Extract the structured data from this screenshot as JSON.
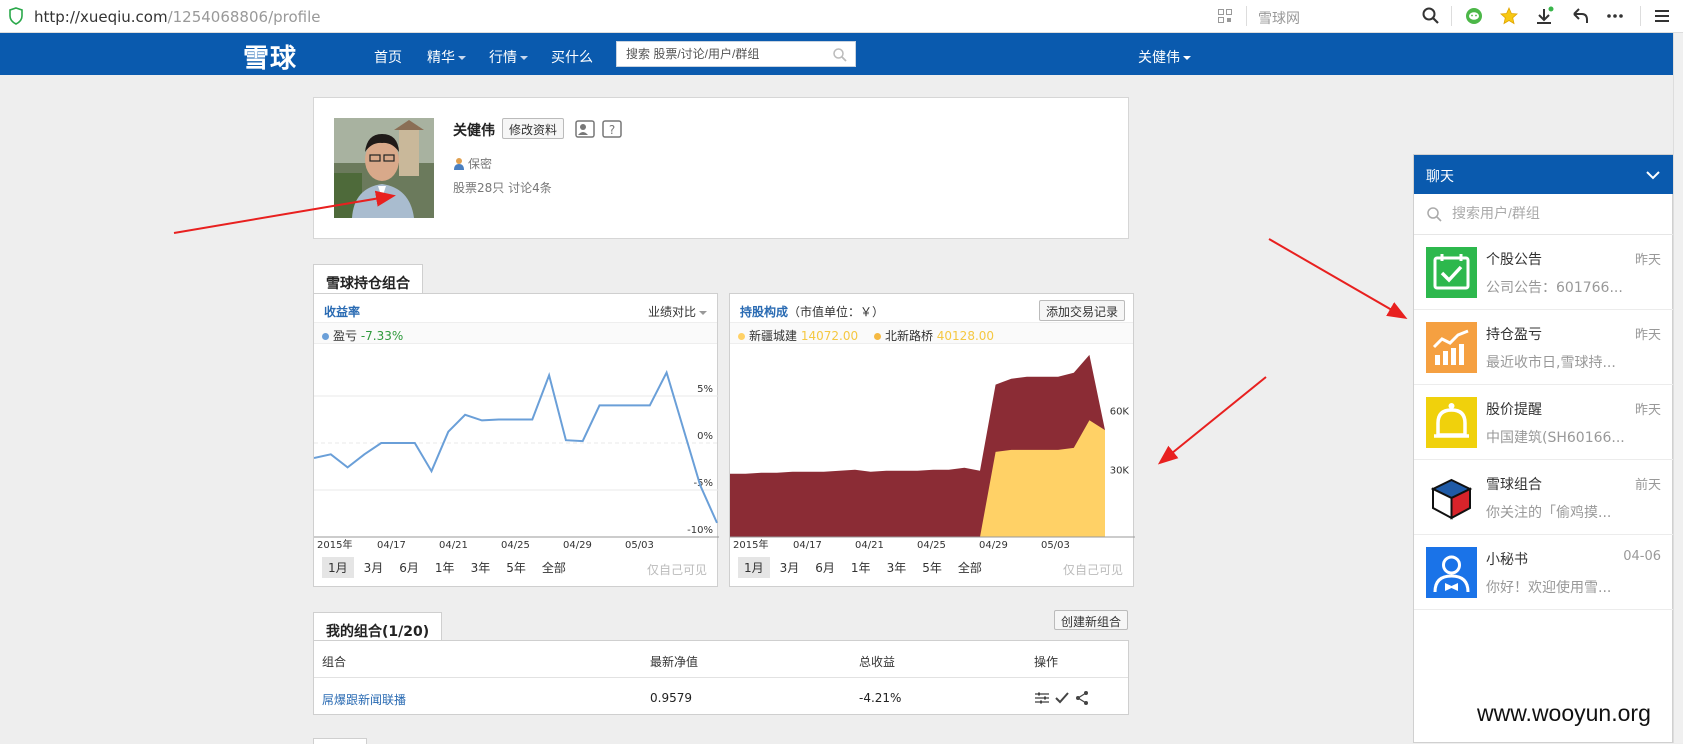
{
  "browser": {
    "url_host": "http://xueqiu.com",
    "url_path": "/1254068806/profile",
    "search_engine": "雪球网"
  },
  "nav": {
    "logo": "雪球",
    "items": [
      {
        "label": "首页",
        "dropdown": false
      },
      {
        "label": "精华",
        "dropdown": true
      },
      {
        "label": "行情",
        "dropdown": true
      },
      {
        "label": "买什么",
        "dropdown": false
      }
    ],
    "search_placeholder": "搜索 股票/讨论/用户/群组",
    "user": "关健伟"
  },
  "profile": {
    "name": "关健伟",
    "edit_label": "修改资料",
    "privacy": "保密",
    "stats": "股票28只  讨论4条"
  },
  "portfolio_tab": "雪球持仓组合",
  "returns_panel": {
    "title": "收益率",
    "compare": "业绩对比",
    "legend_name": "盈亏",
    "legend_value": "-7.33%",
    "ranges": [
      "1月",
      "3月",
      "6月",
      "1年",
      "3年",
      "5年",
      "全部"
    ],
    "selected_range": "1月",
    "private_note": "仅自己可见"
  },
  "holdings_panel": {
    "title": "持股构成",
    "unit": "（市值单位：￥）",
    "add_button": "添加交易记录",
    "legend": [
      {
        "name": "新疆城建",
        "value": "14072.00",
        "color": "#ffd166"
      },
      {
        "name": "北新路桥",
        "value": "40128.00",
        "color": "#f5b942"
      }
    ],
    "ranges": [
      "1月",
      "3月",
      "6月",
      "1年",
      "3年",
      "5年",
      "全部"
    ],
    "selected_range": "1月",
    "private_note": "仅自己可见"
  },
  "chart_data": [
    {
      "type": "line",
      "title": "收益率",
      "x_ticks": [
        "2015年",
        "04/17",
        "04/21",
        "04/25",
        "04/29",
        "05/03"
      ],
      "y_ticks": [
        "5%",
        "0%",
        "-5%",
        "-10%"
      ],
      "ylim": [
        -10,
        10
      ],
      "series": [
        {
          "name": "盈亏",
          "color": "#6a9fd8",
          "values": [
            -1.6,
            -1.2,
            -2.6,
            -1.2,
            0,
            0,
            0,
            -3.0,
            1.2,
            3.0,
            2.4,
            2.5,
            2.5,
            2.5,
            7.2,
            0.3,
            0.2,
            4.0,
            4.0,
            4.0,
            4.0,
            7.5,
            1.5,
            -4.5,
            -8.5
          ]
        }
      ]
    },
    {
      "type": "area",
      "title": "持股构成",
      "x_ticks": [
        "2015年",
        "04/17",
        "04/21",
        "04/25",
        "04/29",
        "05/03"
      ],
      "y_ticks": [
        "60K",
        "30K"
      ],
      "ylim": [
        0,
        95000
      ],
      "series": [
        {
          "name": "北新路桥",
          "color": "#8b2c35",
          "values": [
            32000,
            32000,
            32500,
            32500,
            33000,
            33000,
            33000,
            33500,
            34000,
            33000,
            33500,
            33500,
            33500,
            34000,
            34000,
            35000,
            33500,
            77000,
            80000,
            81000,
            81000,
            81000,
            83000,
            92000,
            54000
          ]
        },
        {
          "name": "新疆城建",
          "color": "#ffd166",
          "values": [
            0,
            0,
            0,
            0,
            0,
            0,
            0,
            0,
            0,
            0,
            0,
            0,
            0,
            0,
            0,
            0,
            0,
            43000,
            44000,
            44000,
            44000,
            44000,
            45000,
            59000,
            54000
          ]
        }
      ]
    }
  ],
  "my_portfolios": {
    "title": "我的组合(1/20)",
    "create_button": "创建新组合",
    "columns": [
      "组合",
      "最新净值",
      "总收益",
      "操作"
    ],
    "rows": [
      {
        "name": "屌爆跟新闻联播",
        "nav": "0.9579",
        "return": "-4.21%"
      }
    ]
  },
  "chat": {
    "title": "聊天",
    "search_placeholder": "搜索用户/群组",
    "items": [
      {
        "title": "个股公告",
        "msg": "公司公告：601766...",
        "time": "昨天",
        "icon": "calendar-check-icon",
        "color": "#2db84d"
      },
      {
        "title": "持仓盈亏",
        "msg": "最近收市日,雪球持...",
        "time": "昨天",
        "icon": "chart-bars-icon",
        "color": "#f5a041"
      },
      {
        "title": "股价提醒",
        "msg": "中国建筑(SH60166...",
        "time": "昨天",
        "icon": "bell-icon",
        "color": "#f0d10c"
      },
      {
        "title": "雪球组合",
        "msg": "你关注的「偷鸡摸...",
        "time": "前天",
        "icon": "cube-icon",
        "color": "#ffffff"
      },
      {
        "title": "小秘书",
        "msg": "你好！欢迎使用雪...",
        "time": "04-06",
        "icon": "assistant-icon",
        "color": "#1a73e8"
      }
    ]
  },
  "watermark": "www.wooyun.org"
}
